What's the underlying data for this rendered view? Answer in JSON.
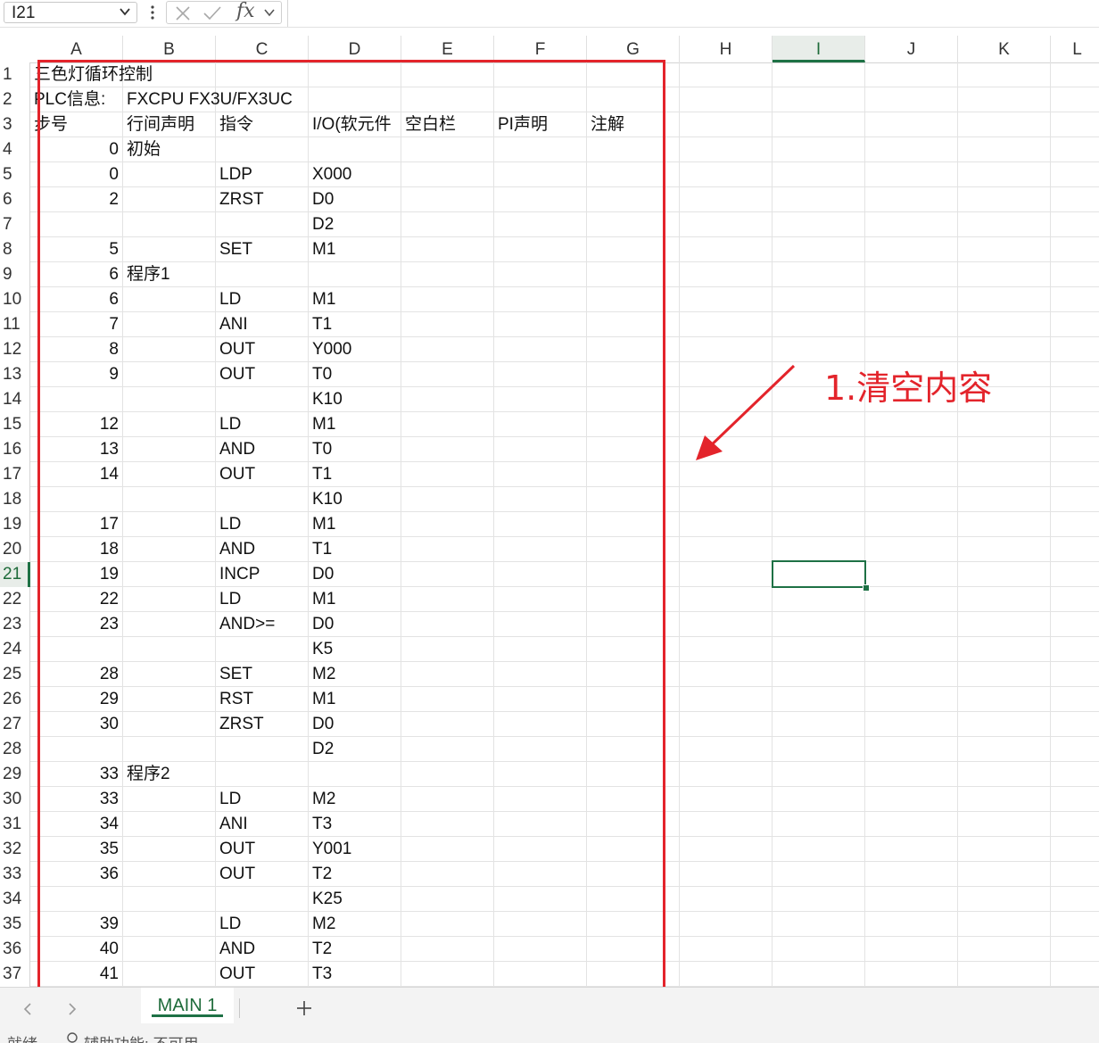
{
  "formula_bar": {
    "name_box": "I21",
    "fx_label": "fx",
    "formula": ""
  },
  "columns": [
    "A",
    "B",
    "C",
    "D",
    "E",
    "F",
    "G",
    "H",
    "I",
    "J",
    "K",
    "L"
  ],
  "selected_column": "I",
  "selected_row": "21",
  "rows": [
    {
      "n": "1",
      "A": "三色灯循环控制",
      "B": "",
      "C": "",
      "D": "",
      "E": "",
      "F": "",
      "G": ""
    },
    {
      "n": "2",
      "A": "PLC信息:",
      "B": "FXCPU FX3U/FX3UC",
      "C": "",
      "D": "",
      "E": "",
      "F": "",
      "G": ""
    },
    {
      "n": "3",
      "A": "步号",
      "B": "行间声明",
      "C": "指令",
      "D": "I/O(软元件",
      "E": "空白栏",
      "F": "PI声明",
      "G": "注解"
    },
    {
      "n": "4",
      "A": "0",
      "B": "初始",
      "C": "",
      "D": ""
    },
    {
      "n": "5",
      "A": "0",
      "B": "",
      "C": "LDP",
      "D": "X000"
    },
    {
      "n": "6",
      "A": "2",
      "B": "",
      "C": "ZRST",
      "D": "D0"
    },
    {
      "n": "7",
      "A": "",
      "B": "",
      "C": "",
      "D": "D2"
    },
    {
      "n": "8",
      "A": "5",
      "B": "",
      "C": "SET",
      "D": "M1"
    },
    {
      "n": "9",
      "A": "6",
      "B": "程序1",
      "C": "",
      "D": ""
    },
    {
      "n": "10",
      "A": "6",
      "B": "",
      "C": "LD",
      "D": "M1"
    },
    {
      "n": "11",
      "A": "7",
      "B": "",
      "C": "ANI",
      "D": "T1"
    },
    {
      "n": "12",
      "A": "8",
      "B": "",
      "C": "OUT",
      "D": "Y000"
    },
    {
      "n": "13",
      "A": "9",
      "B": "",
      "C": "OUT",
      "D": "T0"
    },
    {
      "n": "14",
      "A": "",
      "B": "",
      "C": "",
      "D": "K10"
    },
    {
      "n": "15",
      "A": "12",
      "B": "",
      "C": "LD",
      "D": "M1"
    },
    {
      "n": "16",
      "A": "13",
      "B": "",
      "C": "AND",
      "D": "T0"
    },
    {
      "n": "17",
      "A": "14",
      "B": "",
      "C": "OUT",
      "D": "T1"
    },
    {
      "n": "18",
      "A": "",
      "B": "",
      "C": "",
      "D": "K10"
    },
    {
      "n": "19",
      "A": "17",
      "B": "",
      "C": "LD",
      "D": "M1"
    },
    {
      "n": "20",
      "A": "18",
      "B": "",
      "C": "AND",
      "D": "T1"
    },
    {
      "n": "21",
      "A": "19",
      "B": "",
      "C": "INCP",
      "D": "D0"
    },
    {
      "n": "22",
      "A": "22",
      "B": "",
      "C": "LD",
      "D": "M1"
    },
    {
      "n": "23",
      "A": "23",
      "B": "",
      "C": "AND>=",
      "D": "D0"
    },
    {
      "n": "24",
      "A": "",
      "B": "",
      "C": "",
      "D": "K5"
    },
    {
      "n": "25",
      "A": "28",
      "B": "",
      "C": "SET",
      "D": "M2"
    },
    {
      "n": "26",
      "A": "29",
      "B": "",
      "C": "RST",
      "D": "M1"
    },
    {
      "n": "27",
      "A": "30",
      "B": "",
      "C": "ZRST",
      "D": "D0"
    },
    {
      "n": "28",
      "A": "",
      "B": "",
      "C": "",
      "D": "D2"
    },
    {
      "n": "29",
      "A": "33",
      "B": "程序2",
      "C": "",
      "D": ""
    },
    {
      "n": "30",
      "A": "33",
      "B": "",
      "C": "LD",
      "D": "M2"
    },
    {
      "n": "31",
      "A": "34",
      "B": "",
      "C": "ANI",
      "D": "T3"
    },
    {
      "n": "32",
      "A": "35",
      "B": "",
      "C": "OUT",
      "D": "Y001"
    },
    {
      "n": "33",
      "A": "36",
      "B": "",
      "C": "OUT",
      "D": "T2"
    },
    {
      "n": "34",
      "A": "",
      "B": "",
      "C": "",
      "D": "K25"
    },
    {
      "n": "35",
      "A": "39",
      "B": "",
      "C": "LD",
      "D": "M2"
    },
    {
      "n": "36",
      "A": "40",
      "B": "",
      "C": "AND",
      "D": "T2"
    },
    {
      "n": "37",
      "A": "41",
      "B": "",
      "C": "OUT",
      "D": "T3"
    }
  ],
  "annotation": {
    "text": "1.清空内容",
    "color": "#e3242b"
  },
  "sheet_tabs": [
    {
      "label": "MAIN 1",
      "active": true
    }
  ],
  "status_bar": {
    "ready": "就绪",
    "accessibility": "辅助功能: 不可用"
  },
  "colors": {
    "accent_green": "#1e7145",
    "annotation_red": "#e3242b"
  }
}
